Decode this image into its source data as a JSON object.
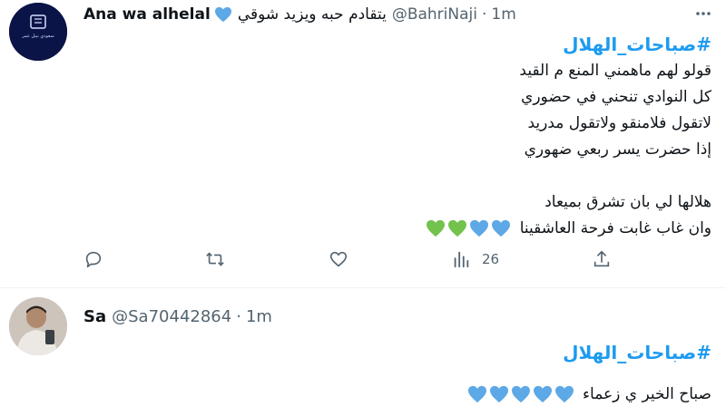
{
  "tweets": [
    {
      "user_name": "Ana wa alhelal",
      "handle": "@BahriNaji",
      "bio": "يتقادم حبه ويزيد شوقي",
      "separator": "·",
      "time": "1m",
      "hashtag": "#صباحات_الهلال",
      "lines": [
        "قولو لهم ماهمني المنع م القيد",
        "كل النوادي تنحني في حضوري",
        "لاتقول فلامنقو ولاتقول مدريد",
        "إذا حضرت يسر ربعي ضهوري",
        "",
        "هلالها لي بان تشرق بميعاد",
        "وان غاب غابت فرحة العاشقينا"
      ],
      "heart_emojis": [
        "blue",
        "blue",
        "green",
        "green"
      ],
      "stats": {
        "views": "26"
      },
      "avatar_text": "سعودي نبيل عمر"
    },
    {
      "user_name": "Sa",
      "handle": "@Sa70442864",
      "separator": "·",
      "time": "1m",
      "hashtag": "#صباحات_الهلال",
      "lines": [
        "صباح الخير ي زعماء"
      ],
      "heart_emojis": [
        "blue",
        "blue",
        "blue",
        "blue",
        "blue"
      ]
    }
  ],
  "colors": {
    "accent": "#1d9bf0",
    "secondary_text": "#536471",
    "heart_blue": "#5da8e6",
    "heart_green": "#73c24e",
    "divider": "#eff3f4"
  },
  "icons": [
    "more-icon",
    "reply-icon",
    "retweet-icon",
    "like-icon",
    "views-icon",
    "share-icon",
    "blue-heart-icon"
  ]
}
